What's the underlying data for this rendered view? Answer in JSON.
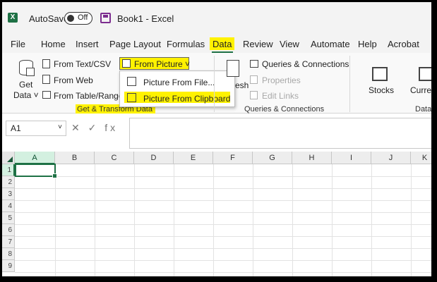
{
  "titlebar": {
    "logo": "X",
    "autosave_label": "AutoSave",
    "toggle_state": "Off",
    "doc_title": "Book1  -  Excel"
  },
  "menu": {
    "tabs": [
      "File",
      "Home",
      "Insert",
      "Page Layout",
      "Formulas",
      "Data",
      "Review",
      "View",
      "Automate",
      "Help",
      "Acrobat"
    ],
    "active": "Data"
  },
  "ribbon": {
    "get_data": {
      "line1": "Get",
      "line2": "Data ˅"
    },
    "from_text_csv": "From Text/CSV",
    "from_web": "From Web",
    "from_table_range": "From Table/Range",
    "from_picture": "From Picture ˅",
    "group_get_transform": "Get & Transform Data",
    "refresh_label": "esh",
    "queries_connections": "Queries & Connections",
    "properties": "Properties",
    "edit_links": "Edit Links",
    "group_queries": "Queries & Connections",
    "stocks": "Stocks",
    "currencies": "Curren",
    "group_data_types": "Data"
  },
  "dropdown": {
    "items": [
      "Picture From File...",
      "Picture From Clipboard"
    ],
    "highlighted": "Picture From Clipboard"
  },
  "formula_bar": {
    "name_box": "A1",
    "name_chevron": "˅",
    "icons": "✕ ✓ fx",
    "value": ""
  },
  "grid": {
    "columns": [
      "A",
      "B",
      "C",
      "D",
      "E",
      "F",
      "G",
      "H",
      "I",
      "J",
      "K"
    ],
    "rows": [
      "1",
      "2",
      "3",
      "4",
      "5",
      "6",
      "7",
      "8",
      "9"
    ],
    "active_cell": "A1"
  },
  "colors": {
    "accent": "#1e7145",
    "highlight": "#fff200"
  }
}
